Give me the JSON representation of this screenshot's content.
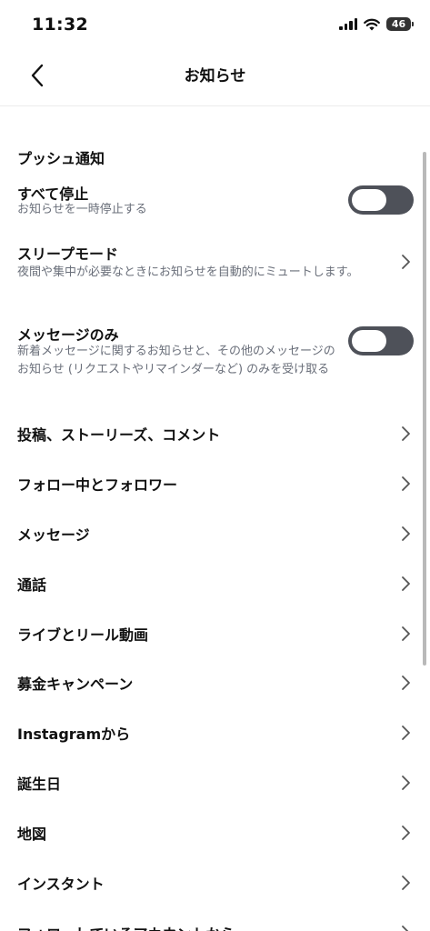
{
  "status_bar": {
    "time": "11:32",
    "battery": "46"
  },
  "header": {
    "title": "お知らせ"
  },
  "section": {
    "title": "プッシュ通知"
  },
  "settings": {
    "pause_all": {
      "title": "すべて停止",
      "description": "お知らせを一時停止する",
      "enabled": false
    },
    "sleep_mode": {
      "title": "スリープモード",
      "description": "夜間や集中が必要なときにお知らせを自動的にミュートします。"
    },
    "messages_only": {
      "title": "メッセージのみ",
      "description": "新着メッセージに関するお知らせと、その他のメッセージのお知らせ (リクエストやリマインダーなど) のみを受け取る",
      "enabled": false
    }
  },
  "menu_items": [
    "投稿、ストーリーズ、コメント",
    "フォロー中とフォロワー",
    "メッセージ",
    "通話",
    "ライブとリール動画",
    "募金キャンペーン",
    "Instagramから",
    "誕生日",
    "地図",
    "インスタント",
    "フォローしているアカウントから"
  ],
  "colors": {
    "toggle_off": "#4e5159",
    "secondary_text": "#6a6f7a"
  },
  "icons": {
    "back": "chevron-left-icon",
    "row": "chevron-right-icon"
  }
}
